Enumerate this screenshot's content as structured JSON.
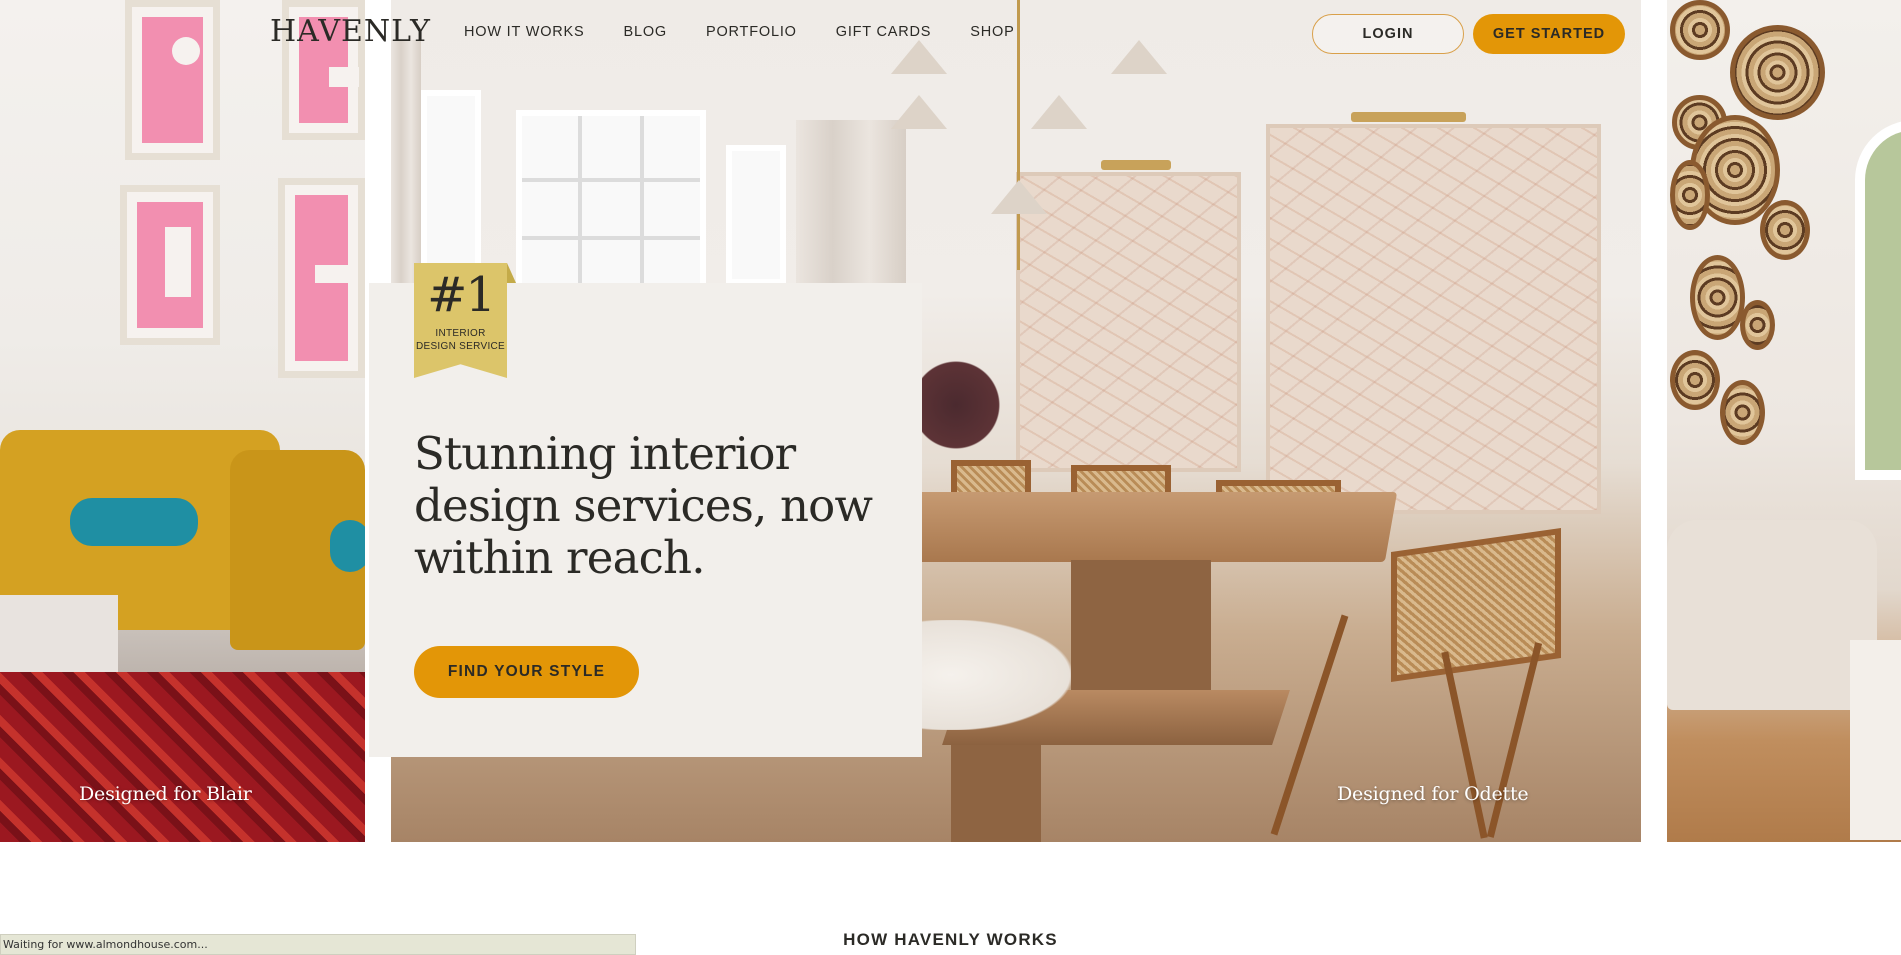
{
  "header": {
    "logo": "HAVENLY",
    "nav": [
      {
        "label": "HOW IT WORKS"
      },
      {
        "label": "BLOG"
      },
      {
        "label": "PORTFOLIO"
      },
      {
        "label": "GIFT CARDS"
      },
      {
        "label": "SHOP"
      }
    ],
    "login_label": "LOGIN",
    "get_started_label": "GET STARTED"
  },
  "hero": {
    "badge_number": "#1",
    "badge_line1": "INTERIOR",
    "badge_line2": "DESIGN SERVICE",
    "headline": "Stunning interior design services, now within reach.",
    "cta_label": "FIND YOUR STYLE",
    "captions": {
      "left": "Designed for Blair",
      "center": "Designed for Odette"
    }
  },
  "section": {
    "title": "HOW HAVENLY WORKS"
  },
  "status_bar": {
    "text": "Waiting for www.almondhouse.com..."
  },
  "colors": {
    "accent": "#e39607",
    "badge": "#dcc56a",
    "card": "#f2efeb",
    "text": "#2b2a26"
  }
}
